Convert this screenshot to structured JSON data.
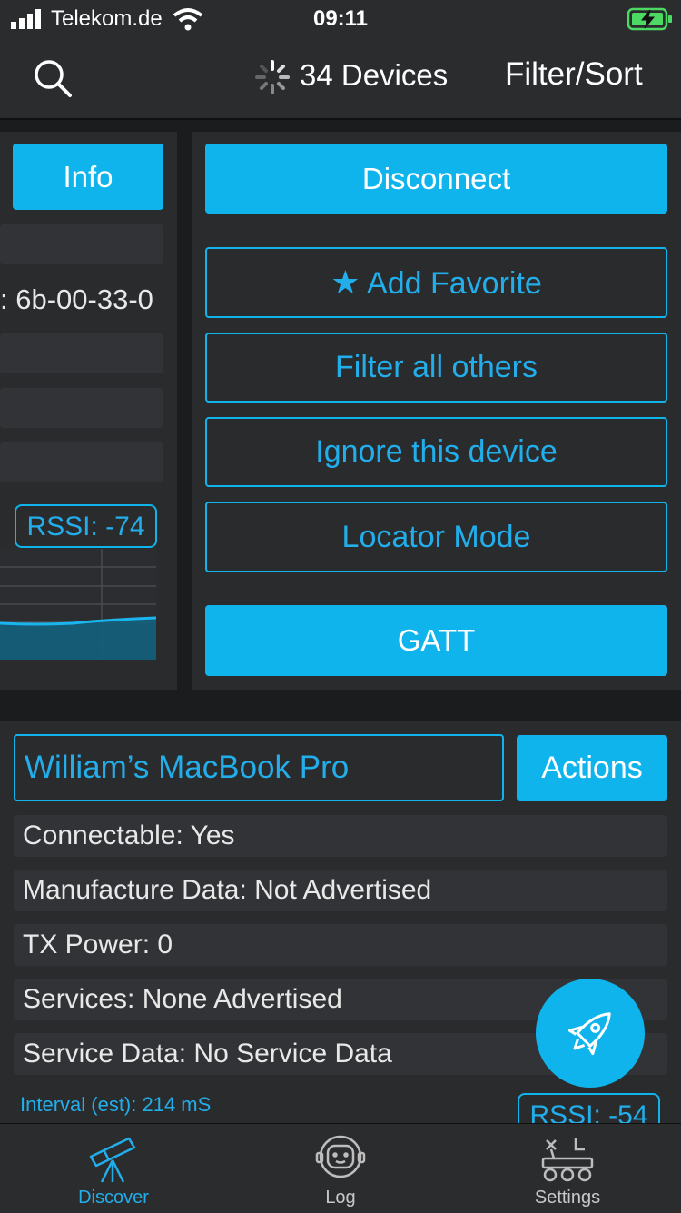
{
  "status_bar": {
    "carrier": "Telekom.de",
    "time": "09:11"
  },
  "nav": {
    "devices_count": "34 Devices",
    "filter_sort": "Filter/Sort"
  },
  "left_card": {
    "info_button": "Info",
    "partial_address": ": 6b-00-33-0",
    "rssi": "RSSI: -74"
  },
  "action_menu": {
    "disconnect": "Disconnect",
    "add_favorite": "Add Favorite",
    "filter_all_others": "Filter all others",
    "ignore_device": "Ignore this device",
    "locator_mode": "Locator Mode",
    "gatt": "GATT"
  },
  "device_card": {
    "name": "William’s MacBook Pro",
    "actions_button": "Actions",
    "rows": [
      "Connectable: Yes",
      "Manufacture Data: Not Advertised",
      "TX Power: 0",
      "Services: None Advertised",
      "Service Data: No Service Data"
    ],
    "interval": "Interval (est): 214 mS",
    "rssi": "RSSI: -54"
  },
  "tabs": [
    {
      "label": "Discover",
      "active": true
    },
    {
      "label": "Log",
      "active": false
    },
    {
      "label": "Settings",
      "active": false
    }
  ],
  "colors": {
    "accent": "#0fb4ec",
    "background": "#1b1c1e",
    "panel": "#2a2b2d"
  },
  "icons": {
    "search": "search-icon",
    "spinner": "spinner-icon",
    "star": "star-icon",
    "rocket": "rocket-icon",
    "telescope": "telescope-icon",
    "astronaut": "astronaut-icon",
    "rover": "rover-icon"
  }
}
